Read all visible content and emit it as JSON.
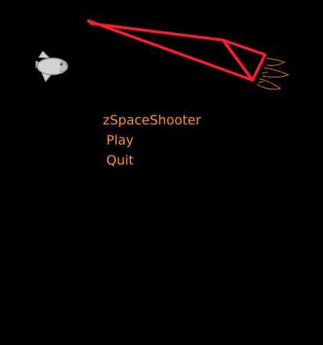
{
  "menu": {
    "title": "zSpaceShooter",
    "options": [
      {
        "label": "Play"
      },
      {
        "label": "Quit"
      }
    ]
  },
  "sprites": {
    "enemy_ship": "small-grey-fish-ship-icon",
    "player_ship": "red-outline-wedge-ship-icon",
    "thrusters": "orange-flame-icon"
  },
  "colors": {
    "background": "#000000",
    "menu_text": "#ff8c1a",
    "player_outline": "#ff1a2e",
    "flame": "#ff7a00",
    "enemy_body": "#c8c8c8"
  }
}
